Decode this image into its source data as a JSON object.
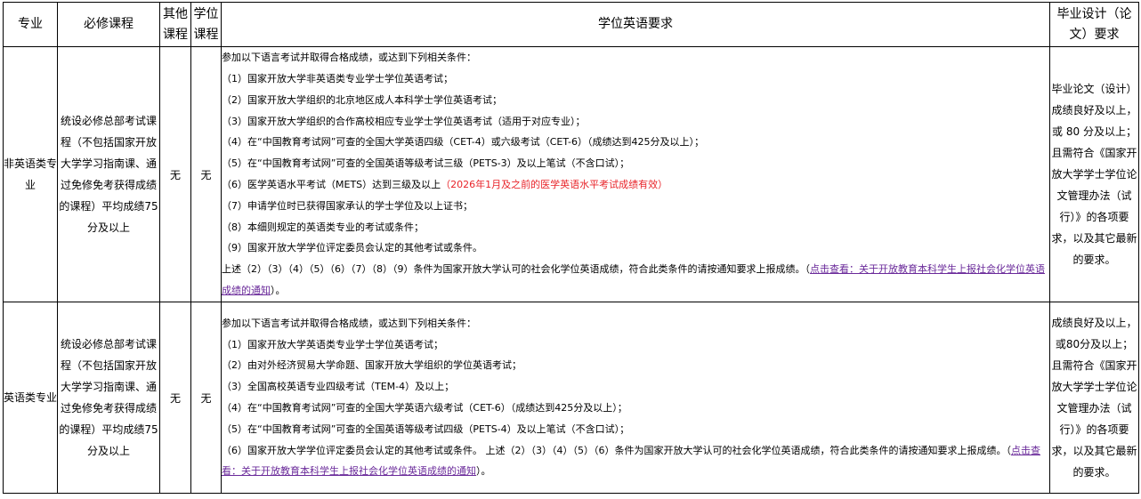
{
  "header": {
    "major": "专业",
    "required_courses": "必修课程",
    "other_courses": "其他课程",
    "degree_courses": "学位课程",
    "english_req": "学位英语要求",
    "thesis": "毕业设计（论文）要求"
  },
  "rows": [
    {
      "major": "非英语类专业",
      "course": "统设必修总部考试课程（不包括国家开放大学学习指南课、通过免修免考获得成绩的课程）平均成绩75分及以上",
      "other": "无",
      "degree": "无",
      "intro": "参加以下语言考试并取得合格成绩，或达到下列相关条件：",
      "items": [
        "（1）国家开放大学非英语类专业学士学位英语考试；",
        "（2）国家开放大学组织的北京地区成人本科学士学位英语考试；",
        "（3）国家开放大学组织的合作高校相应专业学士学位英语考试（适用于对应专业）；",
        "（4）在“中国教育考试网”可查的全国大学英语四级（CET-4）或六级考试（CET-6）（成绩达到425分及以上）；",
        "（5）在“中国教育考试网”可查的全国英语等级考试三级（PETS-3）及以上笔试（不含口试）；"
      ],
      "item6_main": "（6）医学英语水平考试（METS）达到三级及以上",
      "item6_note": "（2026年1月及之前的医学英语水平考试成绩有效）",
      "items_after": [
        "（7）申请学位时已获得国家承认的学士学位及以上证书；",
        "（8）本细则规定的英语类专业的考试或条件；",
        "（9）国家开放大学学位评定委员会认定的其他考试或条件。"
      ],
      "summary": "上述（2）（3）（4）（5）（6）（7）（8）（9）条件为国家开放大学认可的社会化学位英语成绩，符合此类条件的请按通知要求上报成绩。（",
      "link": "点击查看：关于开放教育本科学生上报社会化学位英语成绩的通知",
      "summary_end": "）。",
      "thesis": "毕业论文（设计）成绩良好及以上，或 80 分及以上；且需符合《国家开放大学学士学位论文管理办法（试行）》的各项要求，以及其它最新的要求。"
    },
    {
      "major": "英语类专业",
      "course": "统设必修总部考试课程（不包括国家开放大学学习指南课、通过免修免考获得成绩的课程）平均成绩75分及以上",
      "other": "无",
      "degree": "无",
      "intro": "参加以下语言考试并取得合格成绩，或达到下列相关条件：",
      "items": [
        "（1）国家开放大学英语类专业学士学位英语考试；",
        "（2）由对外经济贸易大学命题、国家开放大学组织的学位英语考试；",
        "（3）全国高校英语专业四级考试（TEM-4）及以上；",
        "（4）在“中国教育考试网”可查的全国大学英语六级考试（CET-6）（成绩达到425分及以上）；",
        "（5）在“中国教育考试网”可查的全国英语等级考试四级（PETS-4）及以上笔试（不含口试）；"
      ],
      "item6": "（6）国家开放大学学位评定委员会认定的其他考试或条件。 上述（2）（3）（4）（5）（6）条件为国家开放大学认可的社会化学位英语成绩，符合此类条件的请按通知要求上报成绩。（",
      "link": "点击查看：关于开放教育本科学生上报社会化学位英语成绩的通知",
      "summary_end": "）。",
      "thesis": "成绩良好及以上，或80分及以上；且需符合《国家开放大学学士学位论文管理办法（试行）》的各项要求，以及其它最新的要求。"
    }
  ],
  "colors": {
    "note_red": "#e8242a",
    "link_purple": "#6a2a9a"
  }
}
